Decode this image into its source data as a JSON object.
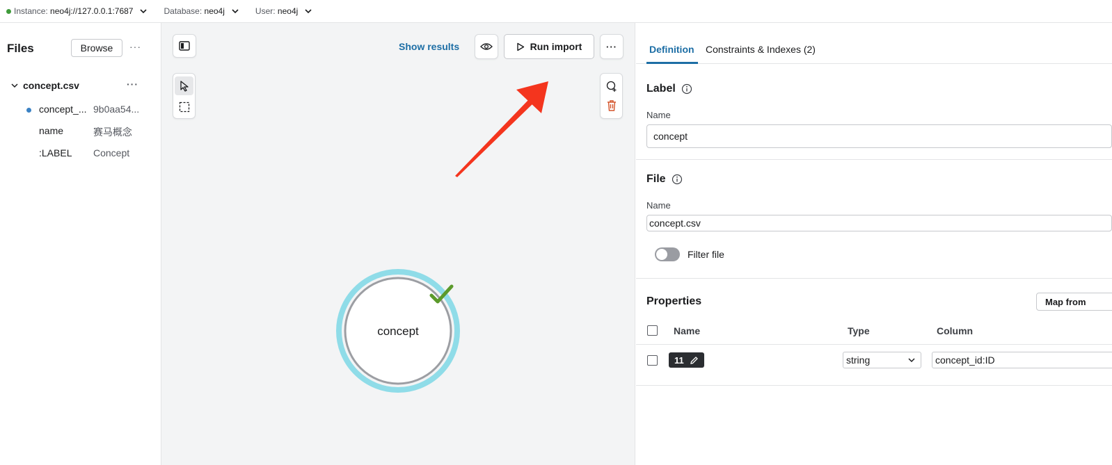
{
  "topbar": {
    "instance_label": "Instance:",
    "instance_value": "neo4j://127.0.0.1:7687",
    "database_label": "Database:",
    "database_value": "neo4j",
    "user_label": "User:",
    "user_value": "neo4j",
    "status_color": "#3f9b3b"
  },
  "files": {
    "title": "Files",
    "browse_label": "Browse",
    "more_label": "···",
    "file_name": "concept.csv",
    "file_more": "···",
    "props": [
      {
        "key": "concept_...",
        "value": "9b0aa54..."
      },
      {
        "key": "name",
        "value": "赛马概念"
      },
      {
        "key": ":LABEL",
        "value": "Concept"
      }
    ]
  },
  "canvas": {
    "show_results": "Show results",
    "run_import": "Run import",
    "more_label": "···",
    "node_label": "concept",
    "accent": "#1d6ea5",
    "node_ring_color": "#8fdce8",
    "check_color": "#5b9a2b",
    "arrow_color": "#f4351e"
  },
  "panel": {
    "tabs": [
      {
        "label": "Definition"
      },
      {
        "label": "Constraints & Indexes (2)"
      }
    ],
    "label_section": {
      "title": "Label",
      "field_label": "Name",
      "value": "concept"
    },
    "file_section": {
      "title": "File",
      "field_label": "Name",
      "value": "concept.csv",
      "filter_label": "Filter file"
    },
    "properties": {
      "title": "Properties",
      "map_button": "Map from",
      "headers": {
        "name": "Name",
        "type": "Type",
        "column": "Column"
      },
      "row": {
        "chip": "11",
        "type": "string",
        "column": "concept_id:ID"
      }
    }
  }
}
